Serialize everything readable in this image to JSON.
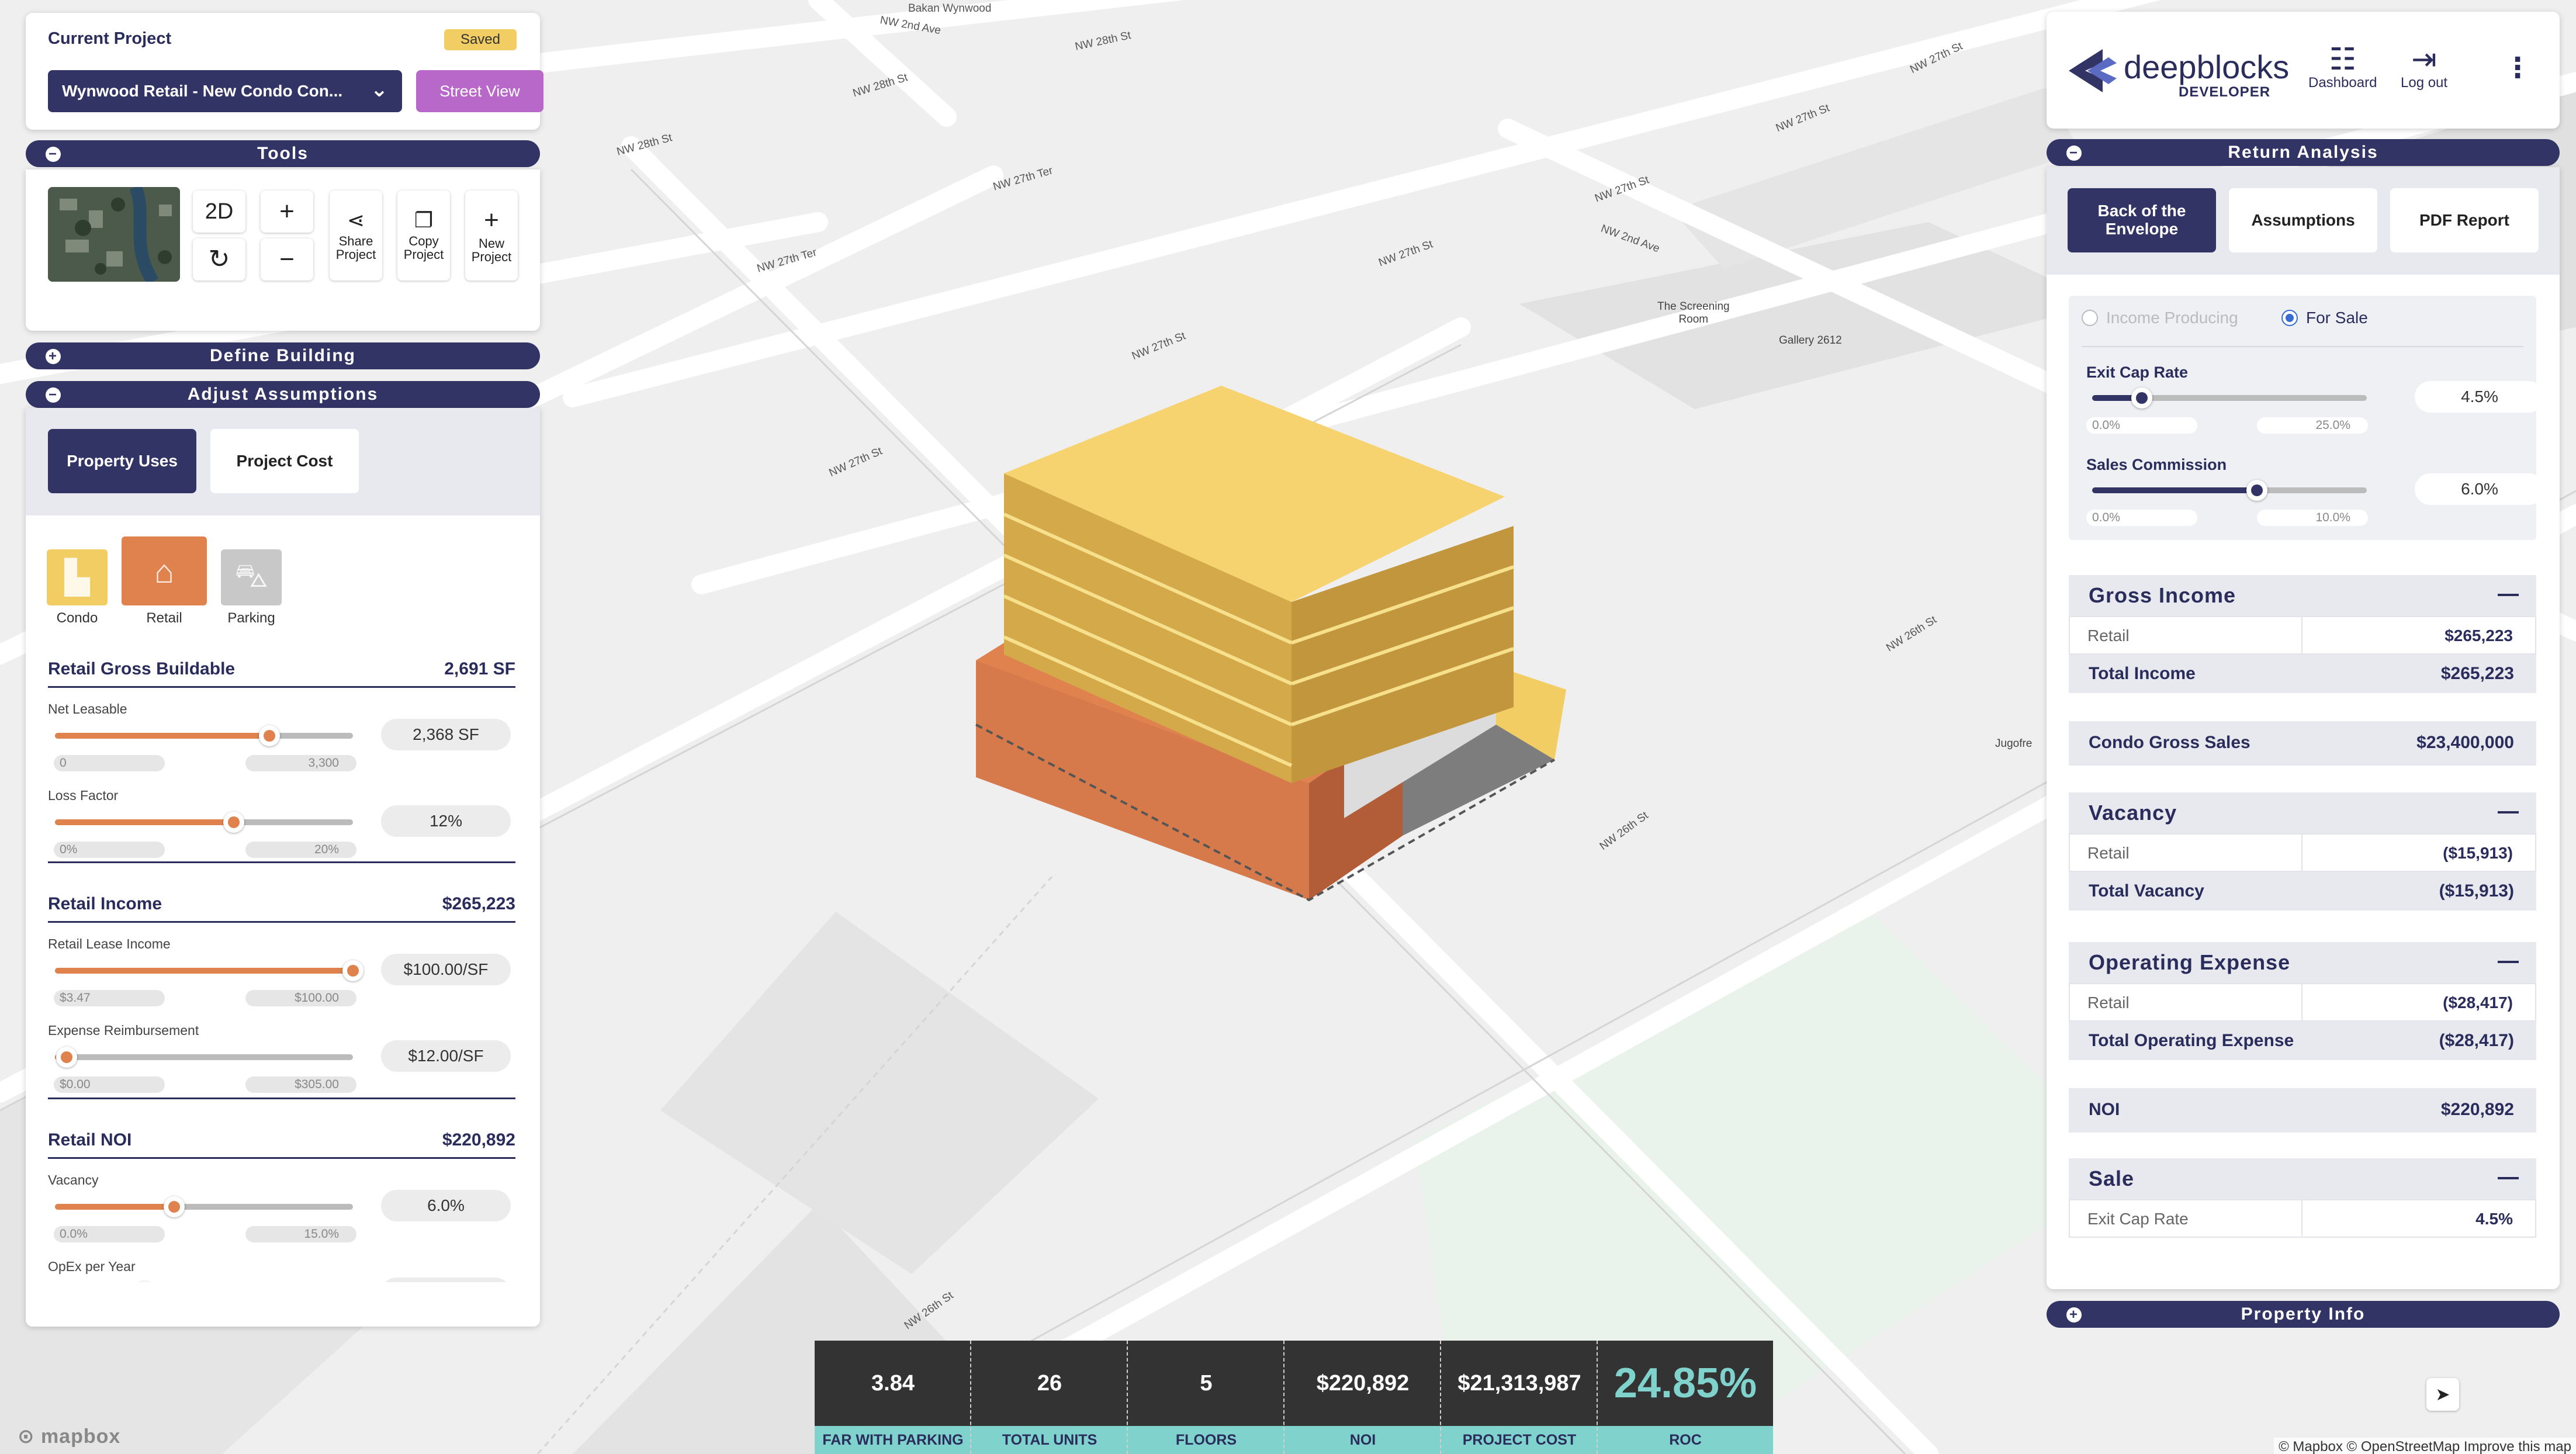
{
  "map": {
    "streets": [
      {
        "text": "NW 2nd Ave"
      },
      {
        "text": "Bakan Wynwood"
      },
      {
        "text": "NW 28th St"
      },
      {
        "text": "NW 28th St"
      },
      {
        "text": "NW 28th St"
      },
      {
        "text": "NW 27th Ter"
      },
      {
        "text": "NW 27th Ter"
      },
      {
        "text": "NW 27th St"
      },
      {
        "text": "NW 27th St"
      },
      {
        "text": "NW 27th St"
      },
      {
        "text": "NW 2nd Ave"
      },
      {
        "text": "NW 27th St"
      },
      {
        "text": "NW 27th St"
      },
      {
        "text": "NW 27th St"
      },
      {
        "text": "NW 26th St"
      },
      {
        "text": "NW 26th St"
      },
      {
        "text": "NW 26th St"
      }
    ],
    "pois": [
      {
        "text": "The Screening\nRoom"
      },
      {
        "text": "Gallery 2612"
      },
      {
        "text": "Jugofre"
      }
    ],
    "logo": "mapbox",
    "attribution": "© Mapbox © OpenStreetMap  Improve this map"
  },
  "current_project": {
    "label": "Current Project",
    "status": "Saved",
    "selected": "Wynwood Retail - New Condo Con...",
    "street_view": "Street View"
  },
  "tools": {
    "title": "Tools",
    "mode_2d": "2D",
    "share": "Share\nProject",
    "copy": "Copy\nProject",
    "new": "New\nProject"
  },
  "define_building": {
    "title": "Define Building"
  },
  "adjust": {
    "title": "Adjust Assumptions",
    "tabs": [
      "Property Uses",
      "Project Cost"
    ],
    "uses": [
      {
        "label": "Condo",
        "color": "#f1cd63"
      },
      {
        "label": "Retail",
        "color": "#e0824e"
      },
      {
        "label": "Parking",
        "color": "#c8c8c8"
      }
    ],
    "sections": [
      {
        "title": "Retail Gross Buildable",
        "value": "2,691 SF",
        "fields": [
          {
            "label": "Net Leasable",
            "min": "0",
            "max": "3,300",
            "value": "2,368 SF",
            "fraction": 0.72
          },
          {
            "label": "Loss Factor",
            "min": "0%",
            "max": "20%",
            "value": "12%",
            "fraction": 0.6
          }
        ]
      },
      {
        "title": "Retail Income",
        "value": "$265,223",
        "fields": [
          {
            "label": "Retail Lease Income",
            "min": "$3.47",
            "max": "$100.00",
            "value": "$100.00/SF",
            "fraction": 1.0
          },
          {
            "label": "Expense Reimbursement",
            "min": "$0.00",
            "max": "$305.00",
            "value": "$12.00/SF",
            "fraction": 0.04
          }
        ]
      },
      {
        "title": "Retail NOI",
        "value": "$220,892",
        "fields": [
          {
            "label": "Vacancy",
            "min": "0.0%",
            "max": "15.0%",
            "value": "6.0%",
            "fraction": 0.4
          },
          {
            "label": "OpEx per Year",
            "min": "",
            "max": "",
            "value": "",
            "fraction": 0.3
          }
        ]
      }
    ]
  },
  "brand": {
    "name": "deepblocks",
    "sub": "DEVELOPER",
    "nav": [
      {
        "label": "Dashboard",
        "icon": "dashboard-icon"
      },
      {
        "label": "Log out",
        "icon": "logout-icon"
      }
    ]
  },
  "return_analysis": {
    "title": "Return Analysis",
    "tabs": [
      "Back of the\nEnvelope",
      "Assumptions",
      "PDF Report"
    ],
    "radio": [
      "Income Producing",
      "For Sale"
    ],
    "exit_cap": {
      "label": "Exit Cap Rate",
      "min": "0.0%",
      "max": "25.0%",
      "value": "4.5%",
      "fraction": 0.18
    },
    "sales_commission": {
      "label": "Sales Commission",
      "min": "0.0%",
      "max": "10.0%",
      "value": "6.0%",
      "fraction": 0.6
    },
    "gross_income": {
      "title": "Gross Income",
      "row_label": "Retail",
      "row_value": "$265,223",
      "total_label": "Total Income",
      "total_value": "$265,223"
    },
    "condo_gross_sales": {
      "label": "Condo Gross Sales",
      "value": "$23,400,000"
    },
    "vacancy": {
      "title": "Vacancy",
      "row_label": "Retail",
      "row_value": "($15,913)",
      "total_label": "Total Vacancy",
      "total_value": "($15,913)"
    },
    "opex": {
      "title": "Operating Expense",
      "row_label": "Retail",
      "row_value": "($28,417)",
      "total_label": "Total Operating Expense",
      "total_value": "($28,417)"
    },
    "noi": {
      "label": "NOI",
      "value": "$220,892"
    },
    "sale": {
      "title": "Sale",
      "row_label": "Exit Cap Rate",
      "row_value": "4.5%"
    }
  },
  "property_info": {
    "title": "Property Info"
  },
  "stats": [
    {
      "value": "3.84",
      "label": "FAR WITH PARKING"
    },
    {
      "value": "26",
      "label": "TOTAL UNITS"
    },
    {
      "value": "5",
      "label": "FLOORS"
    },
    {
      "value": "$220,892",
      "label": "NOI"
    },
    {
      "value": "$21,313,987",
      "label": "PROJECT COST"
    },
    {
      "value": "24.85%",
      "label": "ROC"
    }
  ],
  "colors": {
    "navy": "#333466",
    "condo": "#f1cd63",
    "retail": "#e0824e",
    "teal": "#7fd3cc",
    "purple": "#b768c8"
  }
}
